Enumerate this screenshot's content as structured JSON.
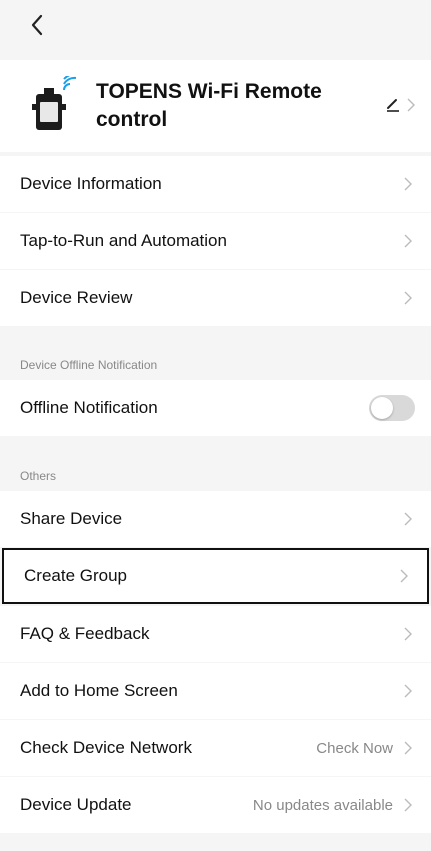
{
  "header": {
    "title": "TOPENS Wi-Fi Remote control"
  },
  "icons": {
    "back": "chevron-left-icon",
    "edit": "pencil-icon",
    "chevron": "chevron-right-icon",
    "device": "wifi-remote-device-icon"
  },
  "rows": {
    "device_information": "Device Information",
    "tap_to_run": "Tap-to-Run and Automation",
    "device_review": "Device Review",
    "offline_notification": "Offline Notification",
    "share_device": "Share Device",
    "create_group": "Create Group",
    "faq_feedback": "FAQ & Feedback",
    "add_to_home": "Add to Home Screen",
    "check_network": "Check Device Network",
    "check_network_value": "Check Now",
    "device_update": "Device Update",
    "device_update_value": "No updates available"
  },
  "sections": {
    "offline_header": "Device Offline Notification",
    "others_header": "Others"
  },
  "toggle": {
    "offline_notification_on": false
  },
  "colors": {
    "background": "#f5f5f5",
    "card": "#ffffff",
    "muted": "#888888",
    "toggle_off": "#d9d9d9"
  }
}
